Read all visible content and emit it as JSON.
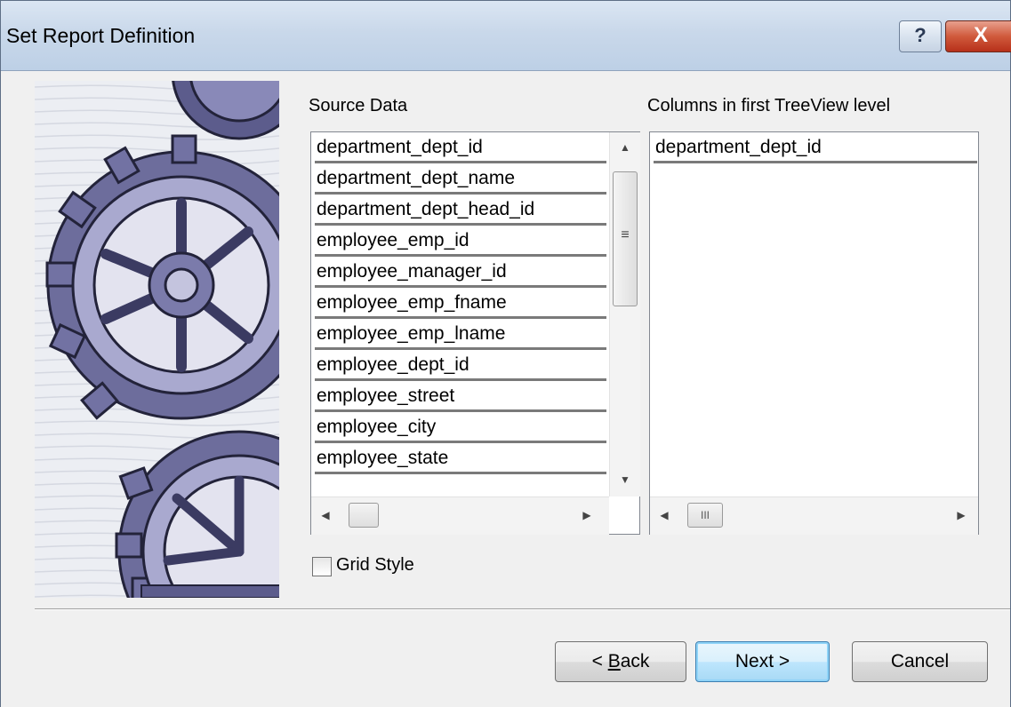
{
  "window": {
    "title": "Set Report Definition",
    "help_label": "?",
    "close_label": "X"
  },
  "source": {
    "label": "Source Data",
    "items": [
      "department_dept_id",
      "department_dept_name",
      "department_dept_head_id",
      "employee_emp_id",
      "employee_manager_id",
      "employee_emp_fname",
      "employee_emp_lname",
      "employee_dept_id",
      "employee_street",
      "employee_city",
      "employee_state"
    ]
  },
  "columns": {
    "label": "Columns in first TreeView level",
    "items": [
      "department_dept_id"
    ]
  },
  "options": {
    "grid_style_label": "Grid Style",
    "grid_style_checked": false
  },
  "buttons": {
    "back_prefix": "< ",
    "back_mnemonic": "B",
    "back_rest": "ack",
    "next_label": "Next >",
    "cancel_label": "Cancel"
  },
  "scroll": {
    "grip_glyph": "≡",
    "hgrip_glyph": "III"
  }
}
